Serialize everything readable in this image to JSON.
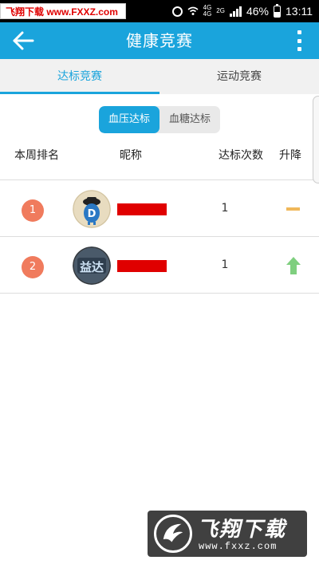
{
  "status_bar": {
    "watermark": "飞翔下载 www.FXXZ.com",
    "network_label_top": "4G",
    "network_label_bottom": "2G",
    "network_label2_top": "4G",
    "network_label2_bottom": "",
    "battery": "46%",
    "time": "13:11"
  },
  "app_bar": {
    "title": "健康竞赛"
  },
  "tabs": [
    {
      "label": "达标竞赛",
      "active": true
    },
    {
      "label": "运动竞赛",
      "active": false
    }
  ],
  "segment": [
    {
      "label": "血压达标",
      "active": true
    },
    {
      "label": "血糖达标",
      "active": false
    }
  ],
  "table": {
    "headers": {
      "rank": "本周排名",
      "nickname": "昵称",
      "count": "达标次数",
      "trend": "升降"
    },
    "rows": [
      {
        "rank": "1",
        "count": "1",
        "trend": "same",
        "avatar": "d-character-avatar"
      },
      {
        "rank": "2",
        "count": "1",
        "trend": "up",
        "avatar": "yida-logo-avatar"
      }
    ]
  },
  "colors": {
    "primary": "#1aa4dc",
    "rank_badge": "#f07b5d",
    "trend_same": "#f0b85a",
    "trend_up": "#7fcf7f",
    "redaction": "#e00000"
  },
  "watermark_bottom": {
    "title": "飞翔下载",
    "url": "www.fxxz.com"
  }
}
